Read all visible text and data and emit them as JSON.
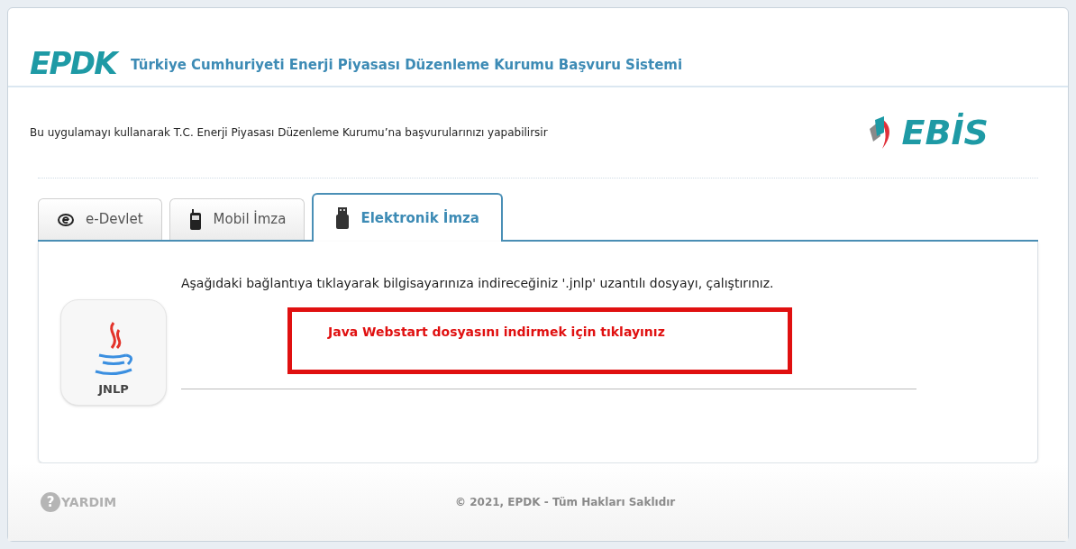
{
  "header": {
    "logo": "EPDK",
    "title": "Türkiye Cumhuriyeti Enerji Piyasası Düzenleme Kurumu Başvuru Sistemi"
  },
  "intro": "Bu uygulamayı kullanarak T.C. Enerji Piyasası Düzenleme Kurumu’na başvurularınızı yapabilirsir",
  "brand": "EBİS",
  "tabs": [
    {
      "label": "e-Devlet",
      "kind": "edevlet",
      "selected": false
    },
    {
      "label": "Mobil İmza",
      "kind": "mobile",
      "selected": false
    },
    {
      "label": "Elektronik İmza",
      "kind": "usb",
      "selected": true
    }
  ],
  "panel": {
    "file_label": "JNLP",
    "instruction": "Aşağıdaki bağlantıya tıklayarak bilgisayarınıza indireceğiniz '.jnlp' uzantılı dosyayı, çalıştırınız.",
    "download_link": "Java Webstart dosyasını indirmek için tıklayınız"
  },
  "footer": {
    "help_mark": "?",
    "help": "YARDIM",
    "copyright": "© 2021, EPDK - Tüm Hakları Saklıdır"
  }
}
